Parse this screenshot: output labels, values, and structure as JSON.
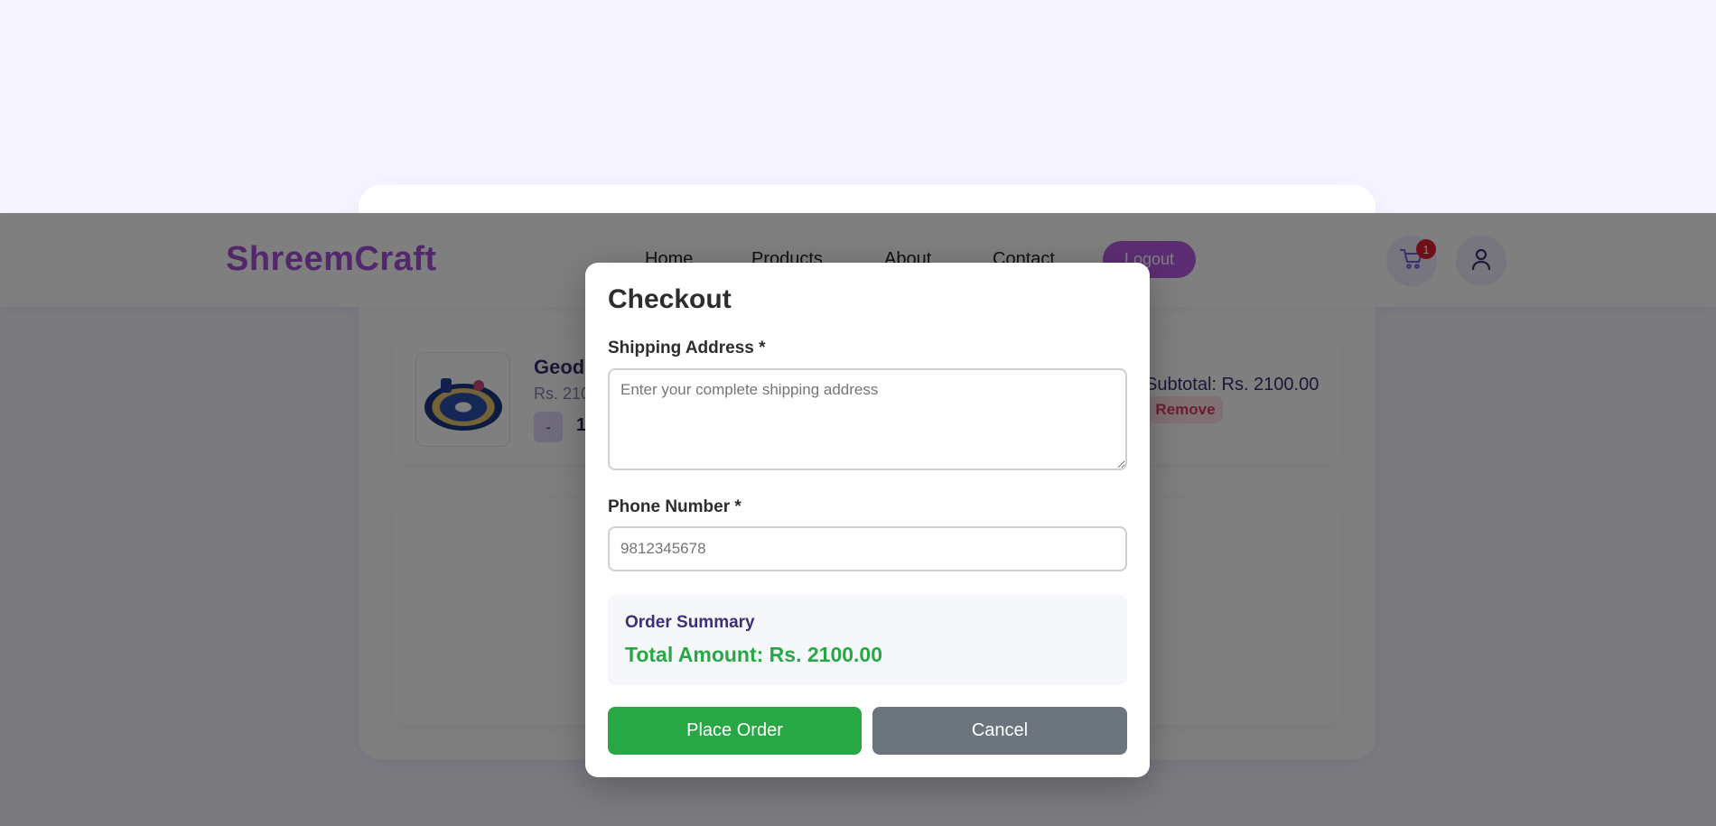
{
  "app": {
    "brand": "ShreemCraft"
  },
  "nav": {
    "links": [
      {
        "label": "Home"
      },
      {
        "label": "Products"
      },
      {
        "label": "About"
      },
      {
        "label": "Contact"
      }
    ],
    "logout_label": "Logout",
    "cart_count": "1",
    "icons": {
      "cart": "cart-icon",
      "user": "user-icon"
    }
  },
  "cart": {
    "item": {
      "name": "Geod",
      "price": "Rs. 210",
      "quantity": "1",
      "minus_label": "-",
      "subtotal": "Subtotal: Rs. 2100.00",
      "remove_label": "Remove"
    }
  },
  "checkout": {
    "title": "Checkout",
    "address_label": "Shipping Address *",
    "address_placeholder": "Enter your complete shipping address",
    "address_value": "",
    "phone_label": "Phone Number *",
    "phone_placeholder": "9812345678",
    "phone_value": "",
    "summary_title": "Order Summary",
    "total_amount": "Total Amount: Rs. 2100.00",
    "place_order_label": "Place Order",
    "cancel_label": "Cancel"
  },
  "colors": {
    "accent": "#b85be6",
    "brand": "#a64fd8",
    "success": "#28a745",
    "secondary": "#6c757d",
    "badge": "#e01e2e"
  }
}
